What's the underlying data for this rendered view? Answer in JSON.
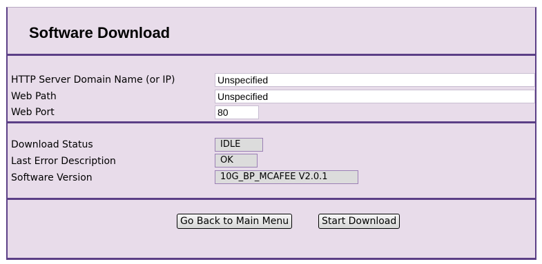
{
  "page": {
    "title": "Software Download"
  },
  "server": {
    "domain_label": "HTTP Server Domain Name (or IP)",
    "domain_value": "Unspecified",
    "path_label": "Web Path",
    "path_value": "Unspecified",
    "port_label": "Web Port",
    "port_value": "80"
  },
  "status": {
    "download_status_label": "Download Status",
    "download_status_value": "IDLE",
    "last_error_label": "Last Error Description",
    "last_error_value": "OK",
    "software_version_label": "Software Version",
    "software_version_value": "10G_BP_MCAFEE V2.0.1"
  },
  "actions": {
    "back_label": "Go Back to Main Menu",
    "start_label": "Start Download"
  },
  "colors": {
    "panel_bg": "#e8dcea",
    "border": "#5b3f86",
    "readonly_bg": "#dcdcdc"
  }
}
